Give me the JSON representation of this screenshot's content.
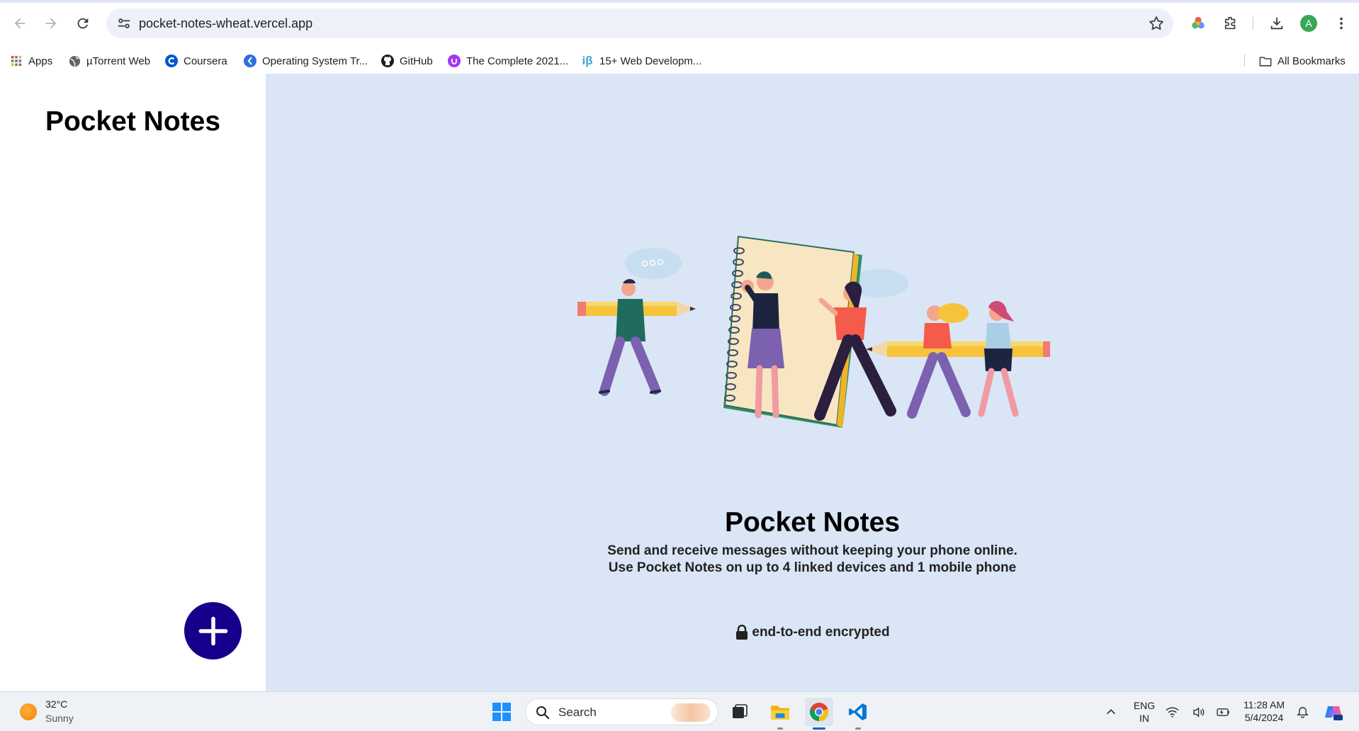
{
  "browser": {
    "url": "pocket-notes-wheat.vercel.app",
    "profile_initial": "A",
    "bookmarks": [
      {
        "label": "Apps",
        "icon": "apps-grid-icon"
      },
      {
        "label": "µTorrent Web",
        "icon": "globe-icon"
      },
      {
        "label": "Coursera",
        "icon": "coursera-icon"
      },
      {
        "label": "Operating System Tr...",
        "icon": "bookmark-site-icon"
      },
      {
        "label": "GitHub",
        "icon": "github-icon"
      },
      {
        "label": "The Complete 2021...",
        "icon": "udemy-icon"
      },
      {
        "label": "15+ Web Developm...",
        "icon": "ib-icon"
      }
    ],
    "all_bookmarks": "All Bookmarks"
  },
  "sidebar": {
    "title": "Pocket Notes"
  },
  "main": {
    "title": "Pocket Notes",
    "description_line1": "Send and receive messages without keeping your phone online.",
    "description_line2": "Use Pocket Notes on up to 4 linked devices and 1 mobile phone",
    "encryption": "end-to-end encrypted"
  },
  "taskbar": {
    "weather_temp": "32°C",
    "weather_desc": "Sunny",
    "search_placeholder": "Search",
    "lang_top": "ENG",
    "lang_bottom": "IN",
    "time": "11:28 AM",
    "date": "5/4/2024"
  },
  "colors": {
    "main_bg": "#dae5f5",
    "add_button": "#16008b",
    "sidebar_bg": "#ffffff"
  }
}
